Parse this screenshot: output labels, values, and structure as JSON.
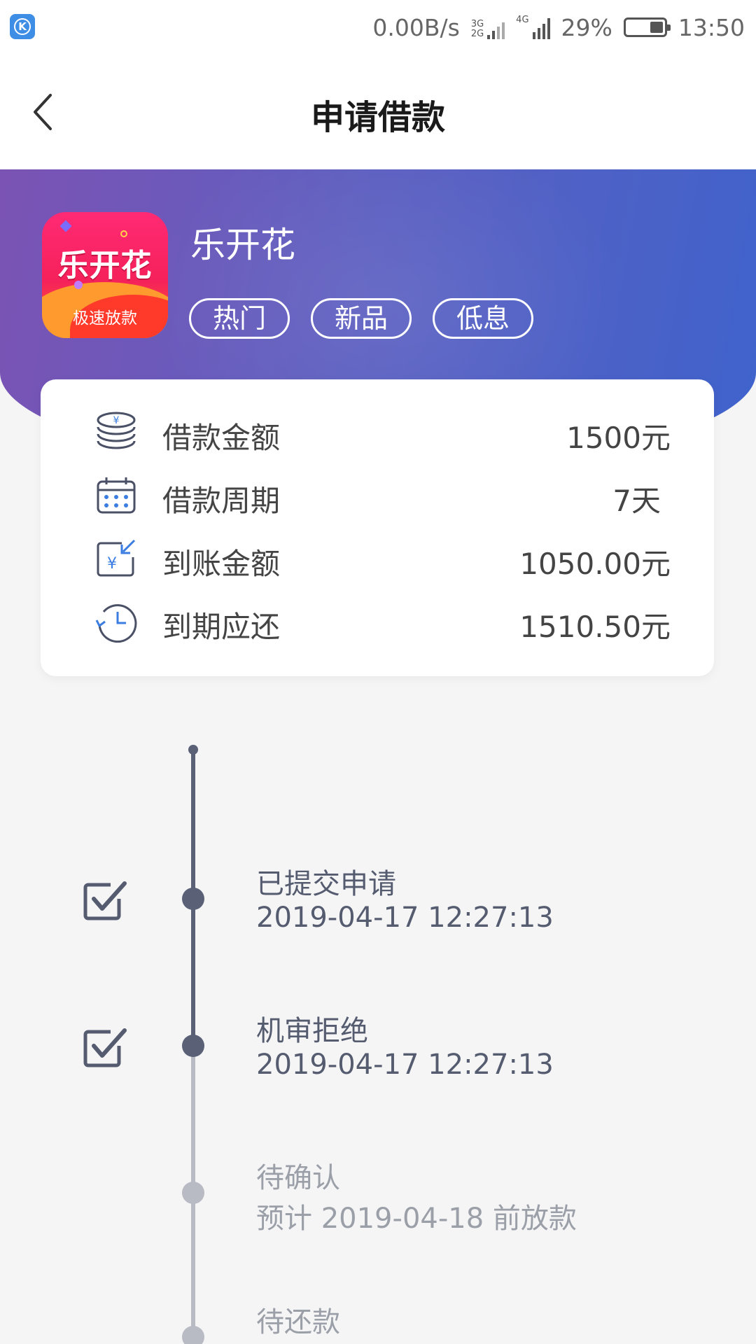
{
  "status_bar": {
    "network_speed": "0.00B/s",
    "sim1_label_top": "3G",
    "sim1_label_bottom": "2G",
    "sim2_label": "4G",
    "battery": "29%",
    "time": "13:50",
    "app_icon_letter": "K"
  },
  "nav": {
    "title": "申请借款",
    "back_icon": "chevron-left-icon"
  },
  "product": {
    "logo_text": "乐开花",
    "logo_subtext": "极速放款",
    "name": "乐开花",
    "tags": [
      "热门",
      "新品",
      "低息"
    ]
  },
  "loan_info": {
    "rows": [
      {
        "icon": "coin-stack-icon",
        "label": "借款金额",
        "value": "1500元"
      },
      {
        "icon": "calendar-icon",
        "label": "借款周期",
        "value": "7天"
      },
      {
        "icon": "money-in-icon",
        "label": "到账金额",
        "value": "1050.00元"
      },
      {
        "icon": "clock-return-icon",
        "label": "到期应还",
        "value": "1510.50元"
      }
    ]
  },
  "timeline": {
    "steps": [
      {
        "title": "已提交申请",
        "subtitle": "2019-04-17 12:27:13",
        "done": true
      },
      {
        "title": "机审拒绝",
        "subtitle": "2019-04-17 12:27:13",
        "done": true
      },
      {
        "title": "待确认",
        "subtitle": "预计 2019-04-18 前放款",
        "done": false
      },
      {
        "title": "待还款",
        "subtitle": "",
        "done": false
      }
    ]
  },
  "colors": {
    "hero_start": "#7b53b4",
    "hero_end": "#3f63cc",
    "timeline_done": "#5a6176",
    "timeline_todo": "#b8bbc4",
    "icon_blue": "#3b7de0"
  }
}
